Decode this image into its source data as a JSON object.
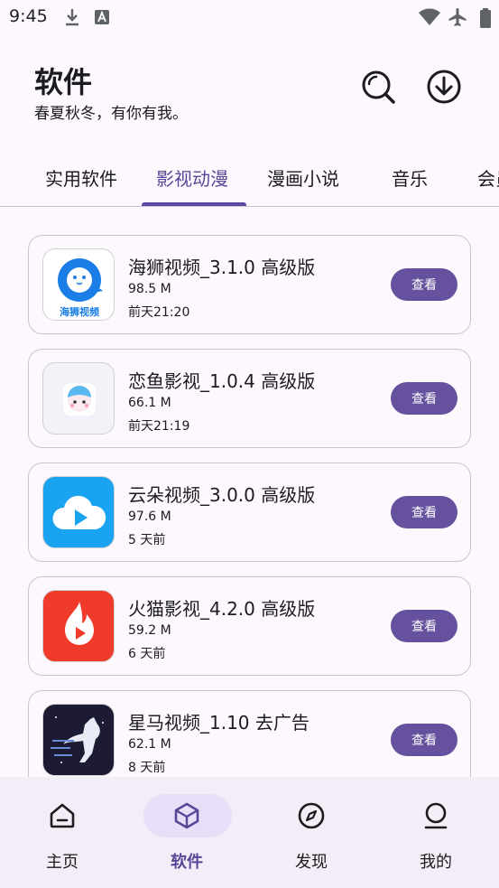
{
  "status_bar": {
    "time": "9:45",
    "icons": [
      "download-icon",
      "font-a-icon",
      "wifi-icon",
      "airplane-icon",
      "battery-icon"
    ]
  },
  "header": {
    "title": "软件",
    "subtitle": "春夏秋冬，有你有我。",
    "icons": [
      "search-icon",
      "download-circle-icon"
    ]
  },
  "tabs": {
    "items": [
      "实用软件",
      "影视动漫",
      "漫画小说",
      "音乐",
      "会员"
    ],
    "active_index": 1
  },
  "apps": [
    {
      "name": "海狮视频_3.1.0 高级版",
      "size": "98.5 M",
      "time": "前天21:20",
      "button": "查看",
      "icon_text": "海狮视频",
      "icon": "sea-lion-icon"
    },
    {
      "name": "恋鱼影视_1.0.4 高级版",
      "size": "66.1 M",
      "time": "前天21:19",
      "button": "查看",
      "icon": "mascot-icon"
    },
    {
      "name": "云朵视频_3.0.0 高级版",
      "size": "97.6 M",
      "time": "5 天前",
      "button": "查看",
      "icon": "cloud-play-icon"
    },
    {
      "name": "火猫影视_4.2.0 高级版",
      "size": "59.2 M",
      "time": "6 天前",
      "button": "查看",
      "icon": "flame-play-icon"
    },
    {
      "name": "星马视频_1.10 去广告",
      "size": "62.1 M",
      "time": "8 天前",
      "button": "查看",
      "icon": "horse-icon"
    }
  ],
  "bottom_nav": {
    "items": [
      {
        "label": "主页",
        "icon": "home-icon"
      },
      {
        "label": "软件",
        "icon": "box-icon"
      },
      {
        "label": "发现",
        "icon": "compass-icon"
      },
      {
        "label": "我的",
        "icon": "person-icon"
      }
    ],
    "active_index": 1
  },
  "colors": {
    "accent": "#5e46a5",
    "button": "#66519f",
    "background": "#fdf8fd",
    "nav_background": "#f3edf7",
    "nav_active_pill": "#e8def8"
  }
}
